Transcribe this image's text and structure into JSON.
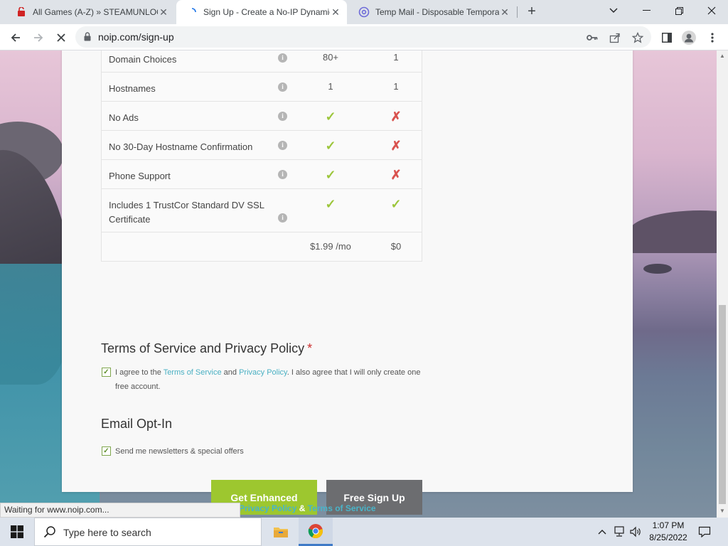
{
  "browser": {
    "tabs": [
      {
        "title": "All Games (A-Z) » STEAMUNLOCKED",
        "active": false
      },
      {
        "title": "Sign Up - Create a No-IP Dynamic",
        "active": true
      },
      {
        "title": "Temp Mail - Disposable Temporary",
        "active": false
      }
    ],
    "url": "noip.com/sign-up",
    "status_text": "Waiting for www.noip.com..."
  },
  "features": {
    "rows": [
      {
        "name": "Domain Choices",
        "enhanced": "80+",
        "free": "1"
      },
      {
        "name": "Hostnames",
        "enhanced": "1",
        "free": "1"
      },
      {
        "name": "No Ads",
        "enhanced": "✓",
        "free": "✗"
      },
      {
        "name": "No 30-Day Hostname Confirmation",
        "enhanced": "✓",
        "free": "✗"
      },
      {
        "name": "Phone Support",
        "enhanced": "✓",
        "free": "✗"
      },
      {
        "name": "Includes 1 TrustCor Standard DV SSL Certificate",
        "enhanced": "✓",
        "free": "✓"
      }
    ],
    "price_enhanced": "$1.99 /mo",
    "price_free": "$0"
  },
  "terms": {
    "title": "Terms of Service and Privacy Policy",
    "required_mark": "*",
    "text_prefix": "I agree to the ",
    "tos_link": "Terms of Service",
    "and": " and ",
    "privacy_link": "Privacy Policy",
    "text_suffix": ". I also agree that I will only create one free account.",
    "checked": true
  },
  "email": {
    "title": "Email Opt-In",
    "label": "Send me newsletters & special offers",
    "checked": true
  },
  "buttons": {
    "enhanced": "Get Enhanced",
    "free": "Free Sign Up"
  },
  "footer": {
    "privacy": "Privacy Policy",
    "amp": " & ",
    "terms": "Terms of Service"
  },
  "taskbar": {
    "search_placeholder": "Type here to search",
    "time": "1:07 PM",
    "date": "8/25/2022"
  },
  "colors": {
    "enhanced_button": "#9dc72f",
    "free_button": "#6c6d70",
    "link": "#4ab0c3",
    "check": "#9cc63b",
    "cross": "#d9534f"
  }
}
